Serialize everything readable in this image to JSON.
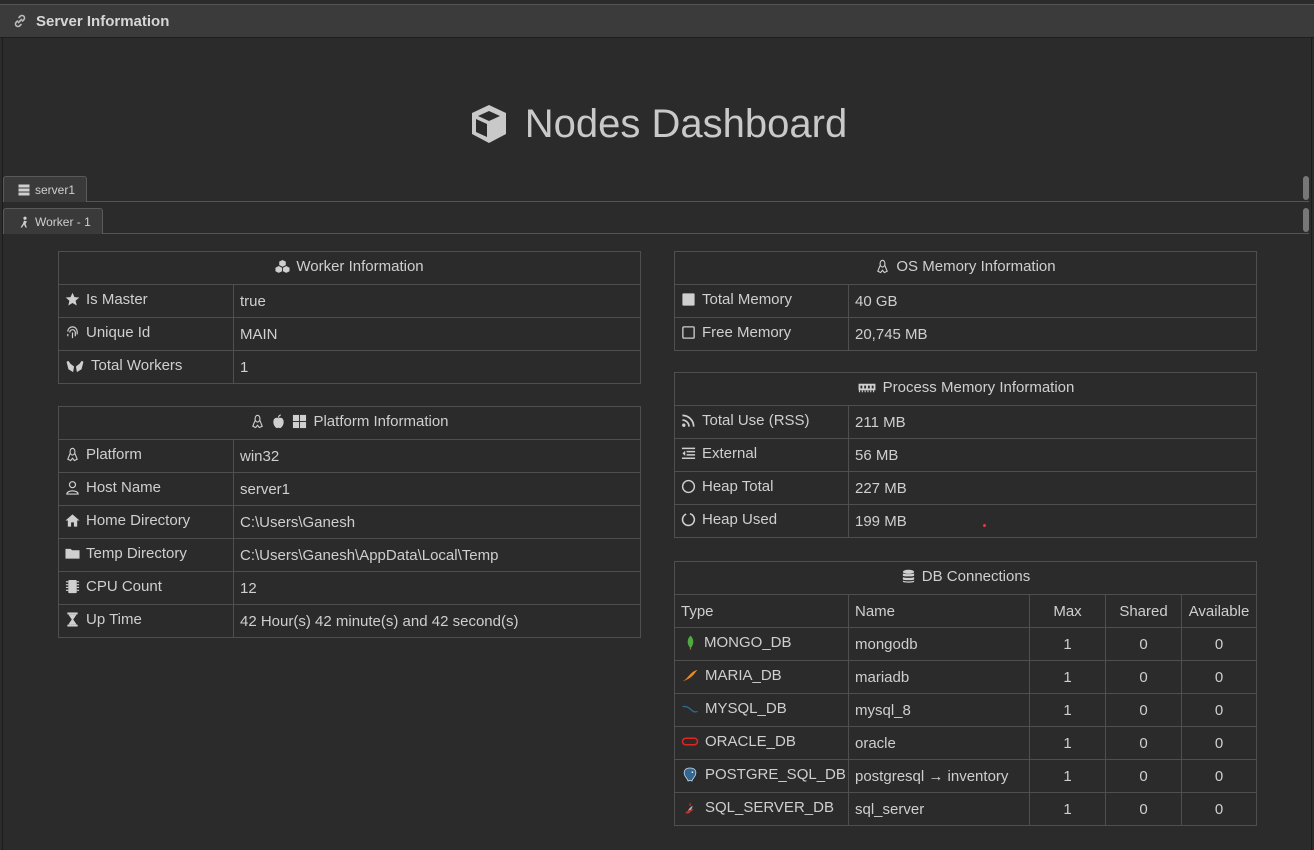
{
  "window": {
    "title": "Server Information",
    "title_icon": "link-icon"
  },
  "dashboard": {
    "title": "Nodes Dashboard",
    "icon": "cube-icon"
  },
  "tabs": {
    "server": {
      "label": "server1",
      "icon": "server-icon"
    },
    "worker": {
      "label": "Worker - 1",
      "icon": "worker-icon"
    }
  },
  "worker_info": {
    "title": "Worker Information",
    "rows": [
      {
        "label": "Is Master",
        "value": "true",
        "icon": "star-icon"
      },
      {
        "label": "Unique Id",
        "value": "MAIN",
        "icon": "fingerprint-icon"
      },
      {
        "label": "Total Workers",
        "value": "1",
        "icon": "hands-icon"
      }
    ]
  },
  "platform_info": {
    "title": "Platform Information",
    "rows": [
      {
        "label": "Platform",
        "value": "win32",
        "icon": "linux-icon"
      },
      {
        "label": "Host Name",
        "value": "server1",
        "icon": "user-icon"
      },
      {
        "label": "Home Directory",
        "value": "C:\\Users\\Ganesh",
        "icon": "home-icon"
      },
      {
        "label": "Temp Directory",
        "value": "C:\\Users\\Ganesh\\AppData\\Local\\Temp",
        "icon": "folder-icon"
      },
      {
        "label": "CPU Count",
        "value": "12",
        "icon": "cpu-icon"
      },
      {
        "label": "Up Time",
        "value": "42 Hour(s) 42 minute(s) and 42 second(s)",
        "icon": "hourglass-icon"
      }
    ]
  },
  "os_memory": {
    "title": "OS Memory Information",
    "rows": [
      {
        "label": "Total Memory",
        "value": "40 GB",
        "icon": "square-filled-icon"
      },
      {
        "label": "Free Memory",
        "value": "20,745 MB",
        "icon": "square-outline-icon"
      }
    ]
  },
  "process_memory": {
    "title": "Process Memory Information",
    "rows": [
      {
        "label": "Total Use (RSS)",
        "value": "211 MB",
        "icon": "rss-icon"
      },
      {
        "label": "External",
        "value": "56 MB",
        "icon": "outdent-icon"
      },
      {
        "label": "Heap Total",
        "value": "227 MB",
        "icon": "circle-outline-icon"
      },
      {
        "label": "Heap Used",
        "value": "199 MB",
        "icon": "circle-notch-icon"
      }
    ]
  },
  "db_connections": {
    "title": "DB Connections",
    "columns": [
      "Type",
      "Name",
      "Max",
      "Shared",
      "Available"
    ],
    "rows": [
      {
        "type": "MONGO_DB",
        "name": "mongodb",
        "max": "1",
        "shared": "0",
        "available": "0",
        "icon": "mongodb-icon"
      },
      {
        "type": "MARIA_DB",
        "name": "mariadb",
        "max": "1",
        "shared": "0",
        "available": "0",
        "icon": "mariadb-icon"
      },
      {
        "type": "MYSQL_DB",
        "name": "mysql_8",
        "max": "1",
        "shared": "0",
        "available": "0",
        "icon": "mysql-icon"
      },
      {
        "type": "ORACLE_DB",
        "name": "oracle",
        "max": "1",
        "shared": "0",
        "available": "0",
        "icon": "oracle-icon"
      },
      {
        "type": "POSTGRE_SQL_DB",
        "name": "postgresql → inventory",
        "max": "1",
        "shared": "0",
        "available": "0",
        "icon": "postgresql-icon"
      },
      {
        "type": "SQL_SERVER_DB",
        "name": "sql_server",
        "max": "1",
        "shared": "0",
        "available": "0",
        "icon": "sqlserver-icon"
      }
    ]
  },
  "colors": {
    "background": "#2b2b2b",
    "border": "#4f4f4f",
    "highlight": "#4fb6e0",
    "text": "#cfcfcf"
  }
}
